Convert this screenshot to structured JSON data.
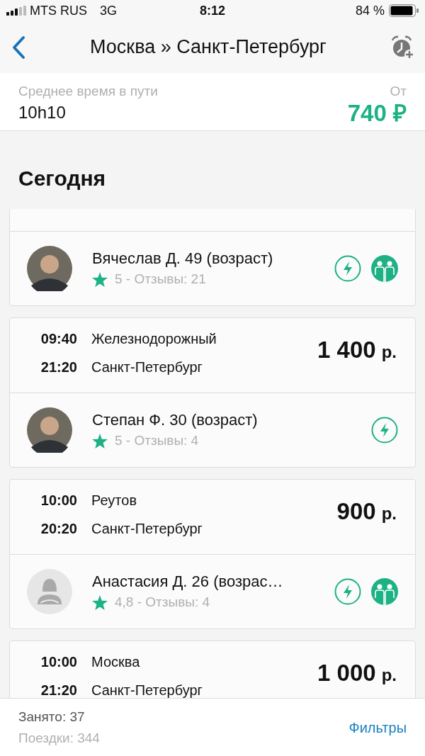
{
  "status_bar": {
    "carrier": "MTS RUS",
    "network": "3G",
    "time": "8:12",
    "battery": "84 %"
  },
  "nav": {
    "title": "Москва » Санкт-Петербург"
  },
  "summary": {
    "label": "Среднее время в пути",
    "duration": "10h10",
    "price_label": "От",
    "price": "740 ₽"
  },
  "section_title": "Сегодня",
  "rides": [
    {
      "driver": {
        "avatar": {
          "kind": "photo"
        },
        "name": "Вячеслав Д. 49 (возраст)",
        "rating": "5 - Отзывы: 21",
        "badges": [
          {
            "kind": "instant"
          },
          {
            "kind": "two_back"
          }
        ]
      }
    },
    {
      "stops": [
        {
          "time": "09:40",
          "place": "Железнодорожный"
        },
        {
          "time": "21:20",
          "place": "Санкт-Петербург"
        }
      ],
      "price": "1 400",
      "currency": "р.",
      "driver": {
        "avatar": {
          "kind": "photo"
        },
        "name": "Степан Ф. 30 (возраст)",
        "rating": "5 - Отзывы: 4",
        "badges": [
          {
            "kind": "instant"
          }
        ]
      }
    },
    {
      "stops": [
        {
          "time": "10:00",
          "place": "Реутов"
        },
        {
          "time": "20:20",
          "place": "Санкт-Петербург"
        }
      ],
      "price": "900",
      "currency": "р.",
      "driver": {
        "avatar": {
          "kind": "placeholder"
        },
        "name": "Анастасия Д. 26 (возрас…",
        "rating": "4,8 - Отзывы: 4",
        "badges": [
          {
            "kind": "instant"
          },
          {
            "kind": "two_back"
          }
        ]
      }
    },
    {
      "stops": [
        {
          "time": "10:00",
          "place": "Москва"
        },
        {
          "time": "21:20",
          "place": "Санкт-Петербург"
        }
      ],
      "price": "1 000",
      "currency": "р."
    }
  ],
  "footer": {
    "booked": "Занято: 37",
    "trips": "Поездки: 344",
    "filters": "Фильтры"
  }
}
